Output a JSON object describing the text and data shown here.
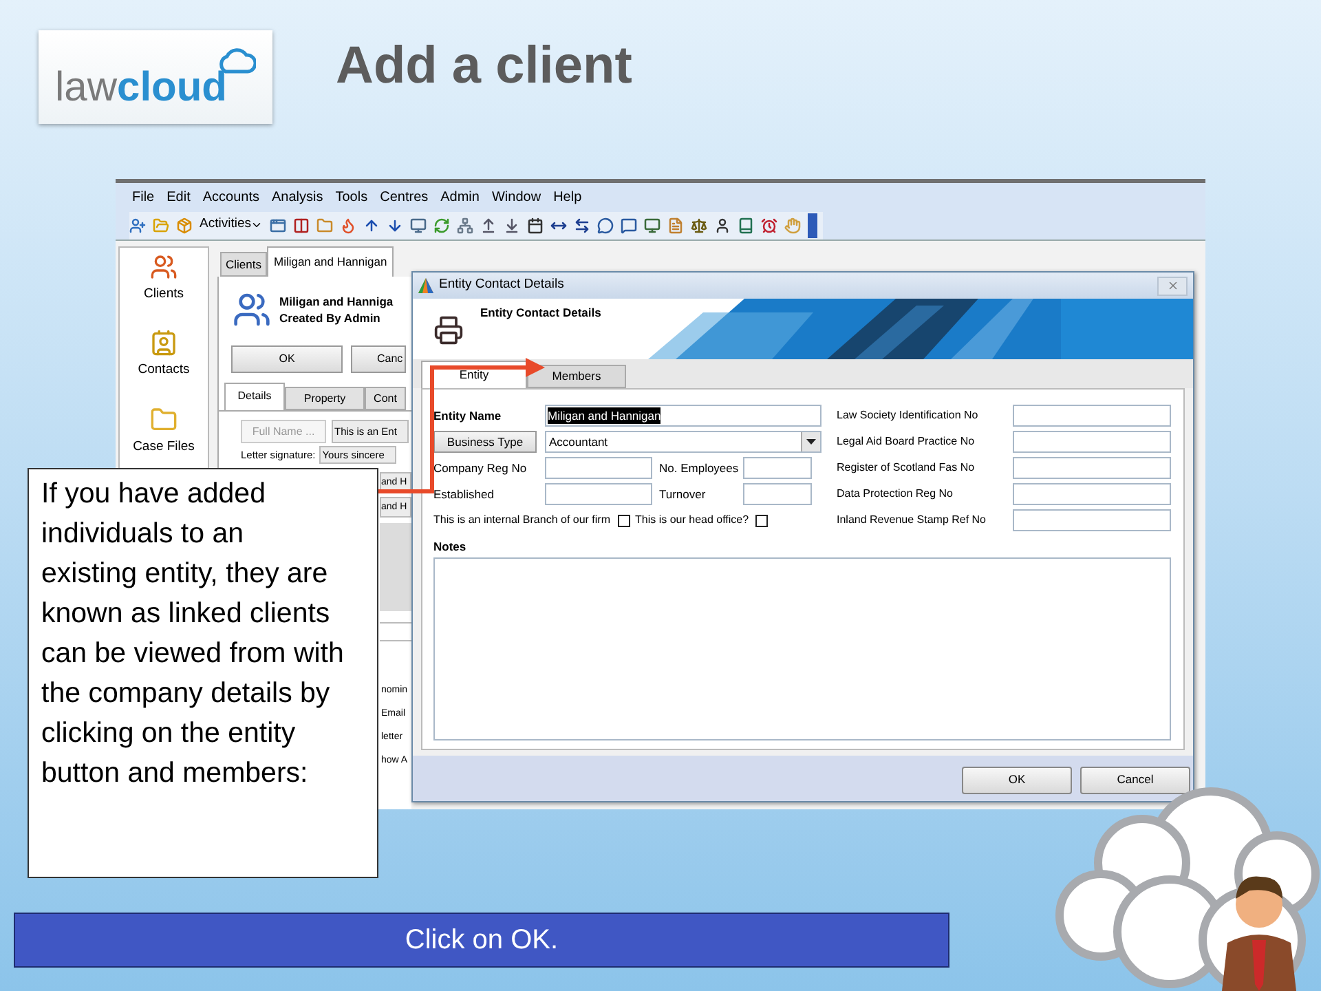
{
  "slide": {
    "logo": {
      "part_1": "law",
      "part_2": "cloud"
    },
    "title": "Add a client"
  },
  "app": {
    "menu": [
      "File",
      "Edit",
      "Accounts",
      "Analysis",
      "Tools",
      "Centres",
      "Admin",
      "Window",
      "Help"
    ],
    "toolbar": {
      "activities": "Activities"
    },
    "sidebar": [
      {
        "label": "Clients"
      },
      {
        "label": "Contacts"
      },
      {
        "label": "Case Files"
      }
    ],
    "tabs": [
      {
        "label": "Clients",
        "selected": false
      },
      {
        "label": "Miligan and Hannigan",
        "selected": true
      }
    ],
    "record": {
      "name": "Miligan and Hanniga",
      "created_by": "Created By Admin"
    },
    "buttons": [
      "OK",
      "Canc"
    ],
    "detail_tabs": [
      {
        "label": "Details",
        "selected": true
      },
      {
        "label": "Property",
        "selected": false
      },
      {
        "label": "Cont",
        "selected": false
      }
    ],
    "full_name_button": "Full Name ...",
    "entity_value": "This is an Ent",
    "letter_signature": {
      "label": "Letter signature:",
      "value": "Yours sincere"
    },
    "partial_fields": [
      "and H",
      "and H"
    ],
    "partial_labels": [
      "nomin",
      "Email",
      "letter",
      "how A"
    ]
  },
  "dialog": {
    "title": "Entity Contact Details",
    "header": "Entity Contact Details",
    "tabs": [
      {
        "label": "Entity",
        "selected": true
      },
      {
        "label": "Members",
        "selected": false
      }
    ],
    "entity_name": {
      "label": "Entity Name",
      "value": "Miligan and Hannigan",
      "text_selected": true
    },
    "business_type": {
      "button": "Business Type",
      "value": "Accountant"
    },
    "pair_rows": [
      {
        "left": "Company Reg No",
        "right": "No. Employees"
      },
      {
        "left": "Established",
        "right": "Turnover"
      }
    ],
    "checkboxes": [
      {
        "label": "This is an internal Branch of our firm",
        "checked": false
      },
      {
        "label": "This is our head office?",
        "checked": false
      }
    ],
    "right_fields": [
      "Law Society Identification No",
      "Legal Aid Board Practice No",
      "Register of Scotland Fas No",
      "Data Protection Reg No",
      "Inland Revenue Stamp Ref No"
    ],
    "notes_label": "Notes",
    "buttons": [
      "OK",
      "Cancel"
    ]
  },
  "callout": "If you have added individuals to an existing entity, they are known as linked clients can be viewed from with the company details by clicking on the entity button and members:",
  "instruction": "Click on OK."
}
